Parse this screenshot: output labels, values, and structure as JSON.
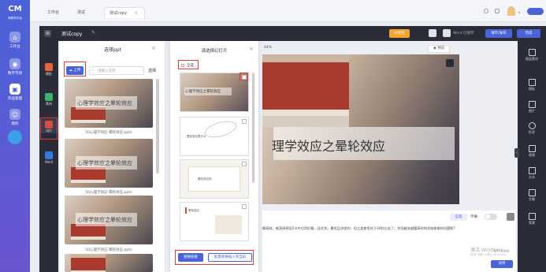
{
  "leftnav": {
    "logo_text": "新教学平台",
    "items": [
      {
        "label": "工作台",
        "icon": "home-icon"
      },
      {
        "label": "数字市场",
        "icon": "market-icon"
      },
      {
        "label": "作品管理",
        "icon": "works-icon"
      },
      {
        "label": "我的",
        "icon": "user-icon"
      }
    ]
  },
  "tabs": [
    {
      "label": "工作台"
    },
    {
      "label": "测试"
    },
    {
      "label": "测试copy"
    }
  ],
  "tab_close": "×",
  "titlebar": {
    "title": "测试copy",
    "btn_ai": "AI创作",
    "status": "Word 已保存",
    "save_publish": "保存/发布",
    "complete": "完成",
    "grid_icon": "grid-icon"
  },
  "tools": [
    {
      "label": "模板"
    },
    {
      "label": "素材"
    },
    {
      "label": "PPT"
    },
    {
      "label": "Word"
    }
  ],
  "panelA": {
    "title": "选择ppt",
    "upload": "上传",
    "search_placeholder": "请输入名称",
    "select": "选择",
    "thumb_text": "心理学效应之晕轮效应",
    "captions": [
      "50心理学效应-晕轮效应.pptx",
      "50心理学效应-晕轮效应.pptx",
      "50心理学效应-晕轮效应.pptx"
    ]
  },
  "panelB": {
    "title": "请选择幻灯片",
    "select_all": "全选",
    "slides": [
      {
        "text": "心理学效应之晕轮效应"
      },
      {
        "text": "晕轮效应是什么"
      },
      {
        "text": "晕轮效应的"
      },
      {
        "text": "晕轮效应"
      }
    ],
    "btn_replace": "替换链接",
    "btn_batch": "批量替换插入到当前"
  },
  "canvas": {
    "zoom": "44%",
    "preview": "预览",
    "slide_title": "理学效应之晕轮效应"
  },
  "rightbar": [
    {
      "label": "图层素材"
    },
    {
      "label": "模板"
    },
    {
      "label": "图片"
    },
    {
      "label": "形状"
    },
    {
      "label": "视频"
    },
    {
      "label": "文本"
    },
    {
      "label": "字幕"
    },
    {
      "label": "背景"
    }
  ],
  "bottom": {
    "tag": "信息",
    "toggle_label": "字幕:",
    "body_text": "最高效，能直接预设5卡片位用好看，还优秀。最优且讲述的，但之类使用对于30秒左右了。你而越发越要高时的初始能够的问题呢?",
    "counter": "87 / 2000",
    "activate": "激活 Windows",
    "activate_sub": "转到\"设置\"以激活 Windows。",
    "try_btn": "试听"
  }
}
